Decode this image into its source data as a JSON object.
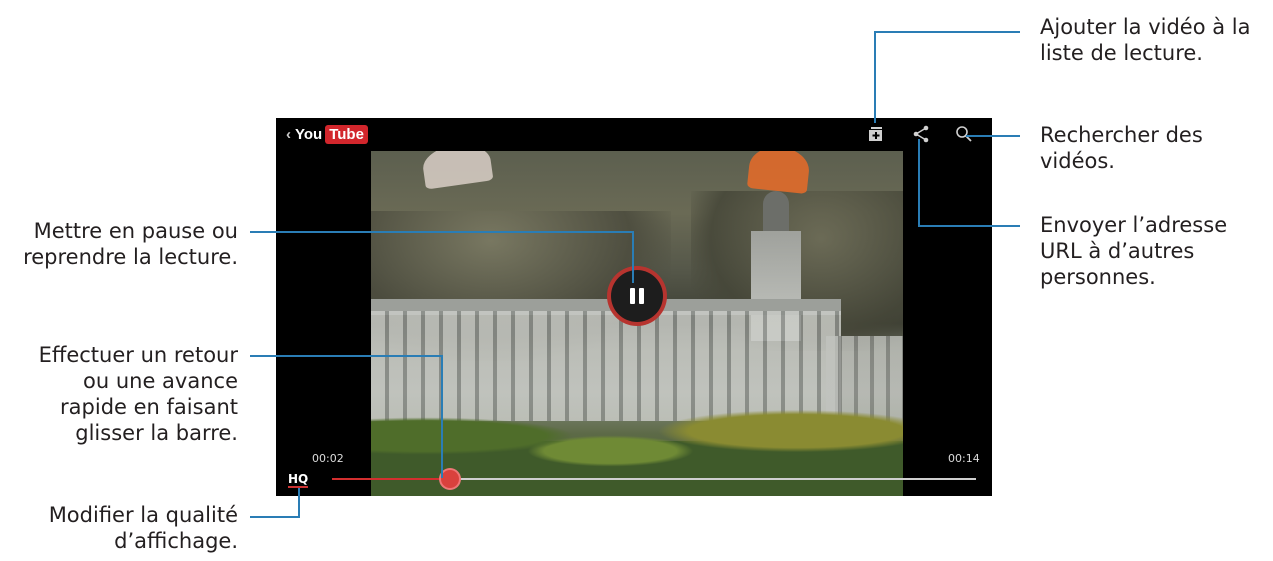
{
  "app": {
    "logo_you": "You",
    "logo_tube": "Tube"
  },
  "player": {
    "elapsed": "00:02",
    "duration": "00:14",
    "quality_label": "HQ",
    "progress_fraction": 0.184
  },
  "icons": {
    "back": "chevron-left-icon",
    "add_to_playlist": "add-playlist-icon",
    "share": "share-icon",
    "search": "search-icon",
    "pause": "pause-icon"
  },
  "colors": {
    "callout_line": "#2a7db5",
    "progress": "#d32f2f",
    "youtube_red": "#d2262c"
  },
  "callouts": {
    "add_playlist": "Ajouter la vidéo à la\nliste de lecture.",
    "search": "Rechercher des\nvidéos.",
    "share": "Envoyer l’adresse\nURL à d’autres\npersonnes.",
    "pause": "Mettre en pause ou\nreprendre la lecture.",
    "seek": "Effectuer un retour\nou une avance\nrapide en faisant\nglisser la barre.",
    "quality": "Modifier la qualité\nd’affichage."
  }
}
